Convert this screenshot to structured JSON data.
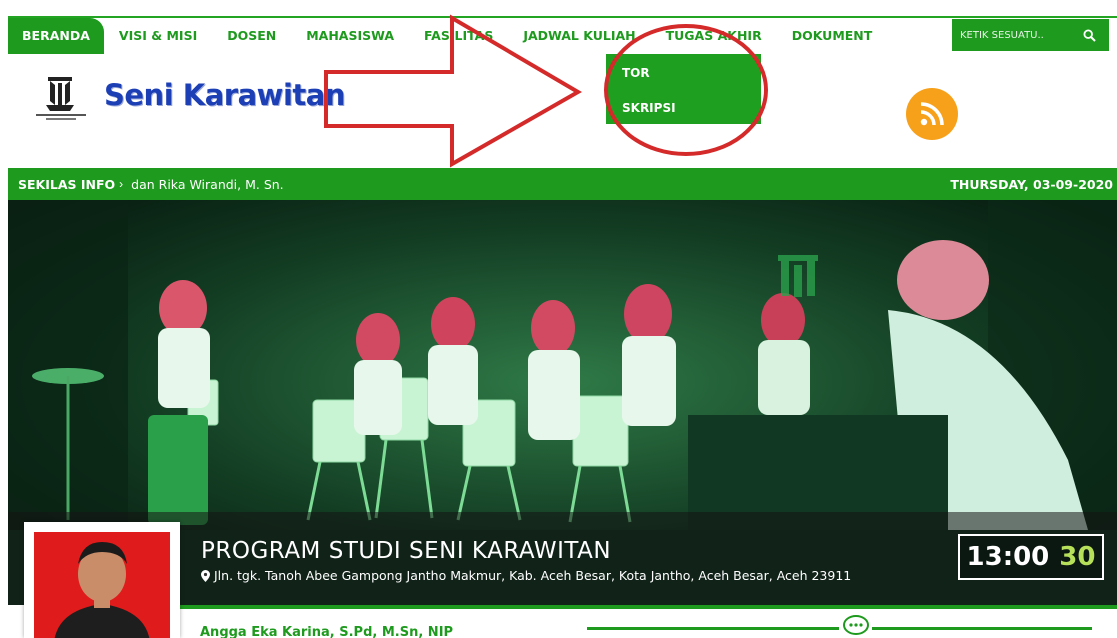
{
  "nav": {
    "items": [
      {
        "label": "BERANDA",
        "active": true
      },
      {
        "label": "VISI & MISI"
      },
      {
        "label": "DOSEN"
      },
      {
        "label": "MAHASISWA"
      },
      {
        "label": "FASILITAS"
      },
      {
        "label": "JADWAL KULIAH"
      },
      {
        "label": "TUGAS AKHIR"
      },
      {
        "label": "DOKUMENT"
      }
    ],
    "search_placeholder": "KETIK SESUATU..",
    "dropdown": [
      "TOR",
      "SKRIPSI"
    ]
  },
  "header": {
    "brand": "Seni Karawitan",
    "logo_icon": "institute-logo-icon",
    "rss_icon": "rss-icon"
  },
  "info": {
    "label": "SEKILAS INFO",
    "arrow": "›",
    "text": "dan Rika Wirandi, M. Sn.",
    "date": "THURSDAY, 03-09-2020"
  },
  "hero": {
    "title": "PROGRAM STUDI SENI KARAWITAN",
    "address": "Jln. tgk. Tanoh Abee Gampong Jantho Makmur, Kab. Aceh Besar, Kota Jantho, Aceh Besar, Aceh 23911",
    "clock_hm": "13:00",
    "clock_s": "30"
  },
  "profile": {
    "name": "Angga Eka Karina, S.Pd, M.Sn, NIP"
  },
  "colors": {
    "primary_green": "#1e9a1e",
    "brand_blue": "#1c3fb5",
    "rss_orange": "#f7a11a",
    "annotation_red": "#d42a2a",
    "clock_seconds": "#b7e05a"
  }
}
